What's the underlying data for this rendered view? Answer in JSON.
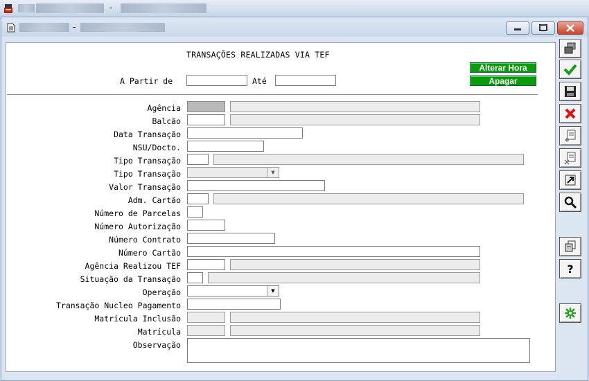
{
  "app": {
    "title_sep": "-"
  },
  "child": {
    "title_sep": "-"
  },
  "form": {
    "title": "TRANSAÇÕES REALIZADAS VIA TEF",
    "a_partir_de": "A Partir de",
    "ate": "Até",
    "btn_alterar_hora": "Alterar Hora",
    "btn_apagar": "Apagar",
    "fields": {
      "agencia": "Agência",
      "balcao": "Balcão",
      "data_transacao": "Data Transação",
      "nsu": "NSU/Docto.",
      "tipo_transacao_1": "Tipo Transação",
      "tipo_transacao_2": "Tipo Transação",
      "valor_transacao": "Valor Transação",
      "adm_cartao": "Adm. Cartão",
      "numero_parcelas": "Número de Parcelas",
      "numero_autorizacao": "Número Autorização",
      "numero_contrato": "Número Contrato",
      "numero_cartao": "Número Cartão",
      "agencia_realizou": "Agência Realizou TEF",
      "situacao": "Situação da Transação",
      "operacao": "Operação",
      "transacao_nucleo": "Transação Nucleo Pagamento",
      "matricula_inclusao": "Matrícula Inclusão",
      "matricula": "Matrícula",
      "observacao": "Observação"
    }
  },
  "toolbar": {
    "items": [
      "restore-icon",
      "confirm-check-icon",
      "save-disk-icon",
      "cancel-x-icon",
      "add-document-icon",
      "delete-document-icon",
      "export-arrow-icon",
      "search-magnifier-icon",
      "print-copy-icon",
      "help-question-icon",
      "refresh-gear-icon"
    ]
  },
  "colors": {
    "green_button": "#0b9a0b",
    "readonly_field": "#ececec",
    "close_red": "#c8442c"
  }
}
